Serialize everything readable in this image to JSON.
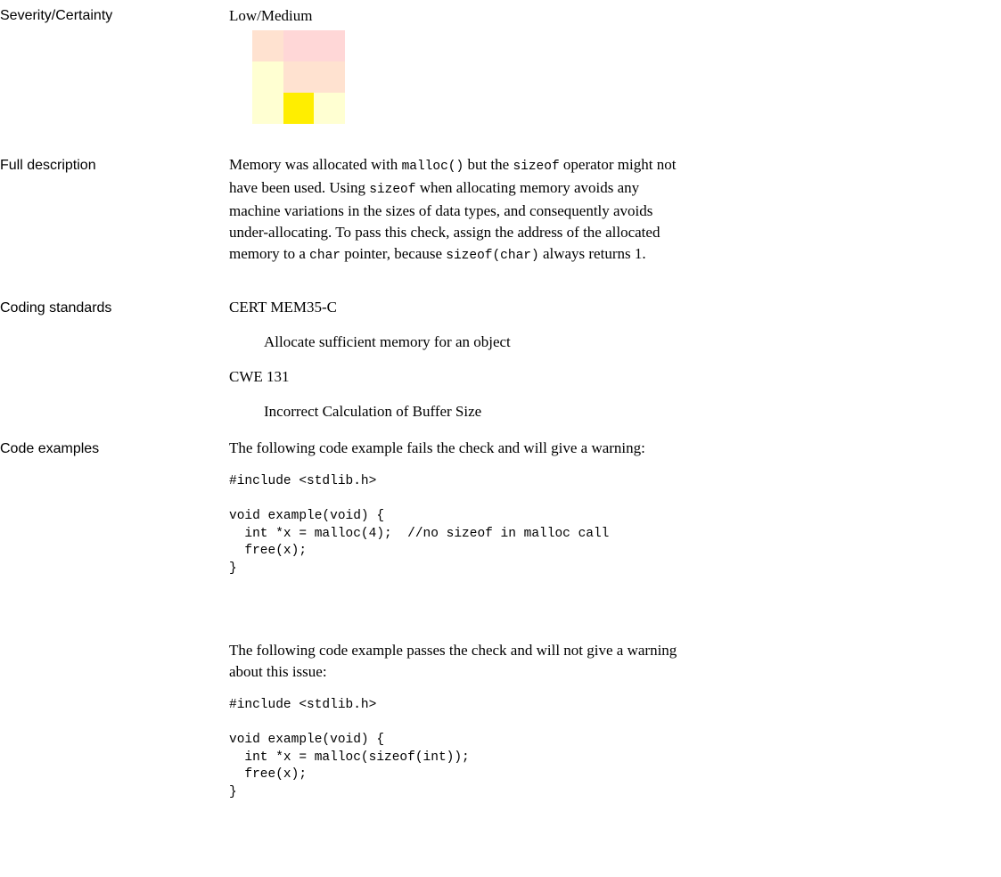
{
  "severity": {
    "label": "Severity/Certainty",
    "value": "Low/Medium",
    "matrix_colors": [
      [
        "#ffe2d0",
        "#ffd7d7",
        "#ffd7d7"
      ],
      [
        "#ffffd2",
        "#ffe2d0",
        "#ffe2d0"
      ],
      [
        "#ffffd2",
        "#ffee00",
        "#ffffd2"
      ]
    ],
    "highlight": {
      "row": 3,
      "column": 2
    }
  },
  "full_description": {
    "label": "Full description",
    "parts": [
      " Memory was allocated with ",
      "malloc()",
      " but the ",
      "sizeof",
      " operator might not have been used. Using ",
      "sizeof",
      " when allocating memory avoids any machine variations in the sizes of data types, and consequently avoids under-allocating.   To pass this check, assign the address of the allocated memory to a ",
      "char",
      " pointer, because ",
      "sizeof(char)",
      " always returns 1."
    ]
  },
  "coding_standards": {
    "label": "Coding standards",
    "items": [
      {
        "id": "CERT MEM35-C",
        "desc": "Allocate sufficient memory for an object"
      },
      {
        "id": "CWE 131",
        "desc": "Incorrect Calculation of Buffer Size"
      }
    ]
  },
  "code_examples": {
    "label": "Code examples",
    "fail_intro": "The following code example fails the check and will give a warning:",
    "fail_code": "#include <stdlib.h>\n\nvoid example(void) {\n  int *x = malloc(4);  //no sizeof in malloc call\n  free(x);\n}",
    "pass_intro": "The following code example passes the check and will not give a warning about this issue:",
    "pass_code": "#include <stdlib.h>\n\nvoid example(void) {\n  int *x = malloc(sizeof(int));\n  free(x);\n}"
  }
}
